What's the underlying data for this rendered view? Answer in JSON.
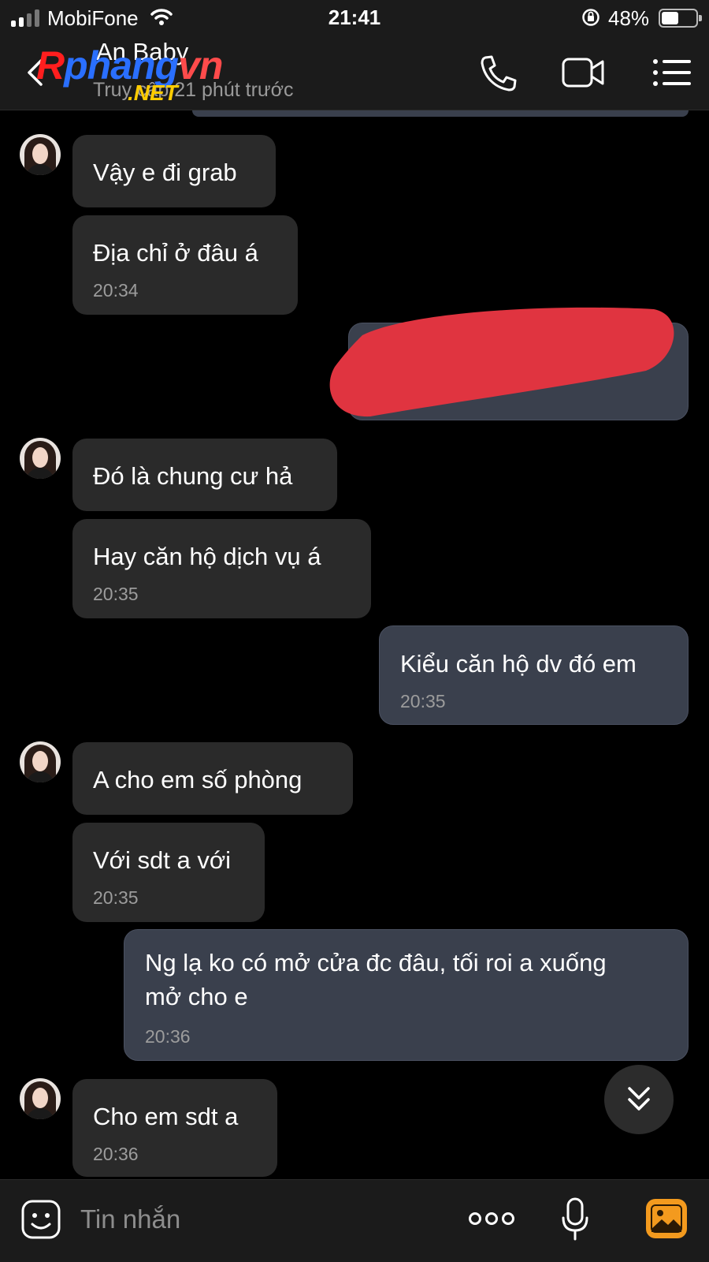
{
  "status_bar": {
    "carrier": "MobiFone",
    "time": "21:41",
    "battery_percent": "48%",
    "battery_level": 0.48
  },
  "header": {
    "contact_name": "An Baby",
    "last_seen": "Truy cập 21 phút trước",
    "watermark": {
      "r": "R",
      "mid": "phang",
      "end": "vn",
      "net": ".NET"
    }
  },
  "messages": [
    {
      "id": "m1",
      "from": "contact",
      "text": "Vậy e đi grab",
      "time": ""
    },
    {
      "id": "m2",
      "from": "contact",
      "text": "Địa chỉ ở đâu á",
      "time": "20:34"
    },
    {
      "id": "m3",
      "from": "me",
      "text": "",
      "time": "",
      "redacted": true
    },
    {
      "id": "m4",
      "from": "contact",
      "text": "Đó là chung cư hả",
      "time": ""
    },
    {
      "id": "m5",
      "from": "contact",
      "text": "Hay căn hộ dịch vụ á",
      "time": "20:35"
    },
    {
      "id": "m6",
      "from": "me",
      "text": "Kiểu căn hộ dv đó em",
      "time": "20:35"
    },
    {
      "id": "m7",
      "from": "contact",
      "text": "A cho em số phòng",
      "time": ""
    },
    {
      "id": "m8",
      "from": "contact",
      "text": "Với sdt a với",
      "time": "20:35"
    },
    {
      "id": "m9",
      "from": "me",
      "text_line1": "Ng lạ ko có mở cửa đc đâu, tối roi a xuống",
      "text_line2": "mở cho e",
      "time": "20:36"
    },
    {
      "id": "m10",
      "from": "contact",
      "text": "Cho em sdt a",
      "time": "20:36"
    }
  ],
  "composer": {
    "placeholder": "Tin nhắn"
  },
  "icons": {
    "back": "chevron-left-icon",
    "call": "phone-icon",
    "video": "video-camera-icon",
    "menu": "list-menu-icon",
    "scroll": "double-chevron-down-icon",
    "sticker": "sticker-face-icon",
    "more": "more-dots-icon",
    "mic": "microphone-icon",
    "image": "image-icon"
  },
  "colors": {
    "background": "#000000",
    "incoming_bubble": "#2a2a2a",
    "outgoing_bubble": "#3a404d",
    "redaction": "#e03440",
    "image_icon": "#f39a1e"
  }
}
